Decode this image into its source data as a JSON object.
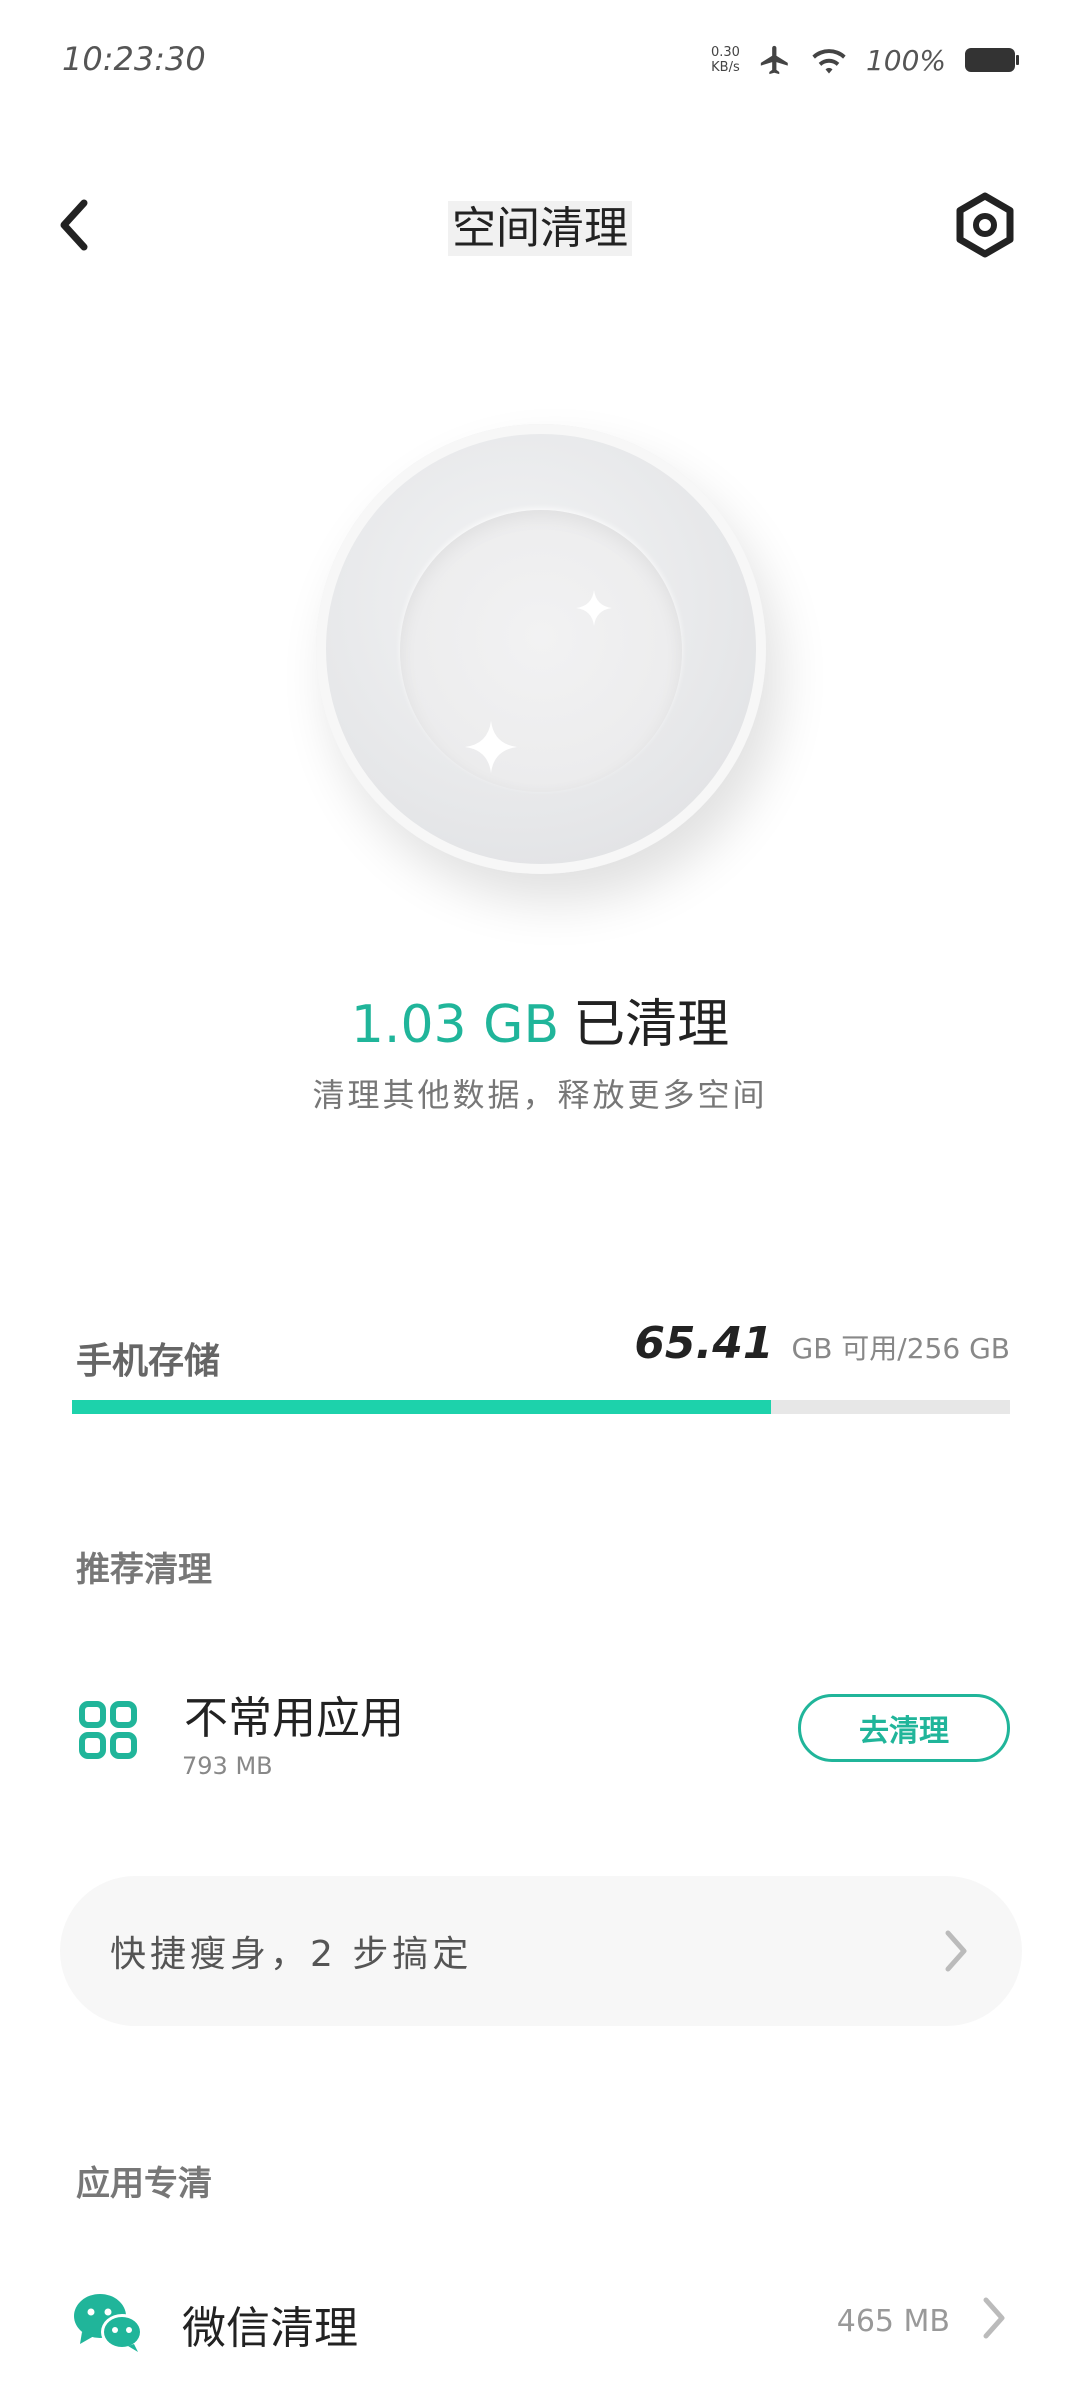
{
  "status_bar": {
    "time": "10:23:30",
    "net_speed_value": "0.30",
    "net_speed_unit": "KB/s",
    "battery_percent": "100%"
  },
  "header": {
    "title": "空间清理",
    "back_icon": "chevron-left-icon",
    "settings_icon": "settings-gear-icon"
  },
  "summary": {
    "cleaned_amount": "1.03 GB",
    "cleaned_label": "已清理",
    "subtitle": "清理其他数据，释放更多空间"
  },
  "storage": {
    "label": "手机存储",
    "available": "65.41",
    "rest": "GB 可用/256 GB",
    "used_fraction": 0.745,
    "bar_color": "#1dd2ab"
  },
  "recommend": {
    "section_title": "推荐清理",
    "item": {
      "title": "不常用应用",
      "size": "793 MB",
      "button_label": "去清理",
      "icon": "apps-grid-icon"
    }
  },
  "quick_slim": {
    "text": "快捷瘦身，2 步搞定"
  },
  "app_specific": {
    "section_title": "应用专清",
    "item": {
      "title": "微信清理",
      "size": "465 MB",
      "icon": "wechat-icon"
    }
  },
  "accent_color": "#20b59a"
}
